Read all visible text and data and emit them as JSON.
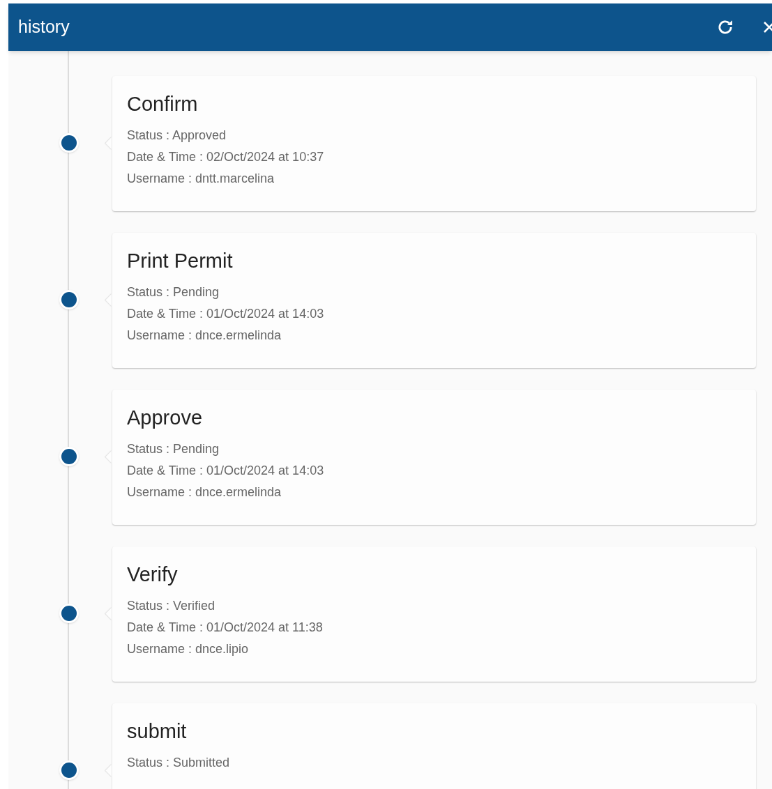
{
  "header": {
    "title": "history"
  },
  "entries": [
    {
      "title": "Confirm",
      "status": "Status : Approved",
      "datetime": "Date & Time : 02/Oct/2024 at 10:37",
      "username": "Username : dntt.marcelina"
    },
    {
      "title": "Print Permit",
      "status": "Status : Pending",
      "datetime": "Date & Time : 01/Oct/2024 at 14:03",
      "username": "Username : dnce.ermelinda"
    },
    {
      "title": "Approve",
      "status": "Status : Pending",
      "datetime": "Date & Time : 01/Oct/2024 at 14:03",
      "username": "Username : dnce.ermelinda"
    },
    {
      "title": "Verify",
      "status": "Status : Verified",
      "datetime": "Date & Time : 01/Oct/2024 at 11:38",
      "username": "Username : dnce.lipio"
    },
    {
      "title": "submit",
      "status": "Status : Submitted"
    }
  ]
}
